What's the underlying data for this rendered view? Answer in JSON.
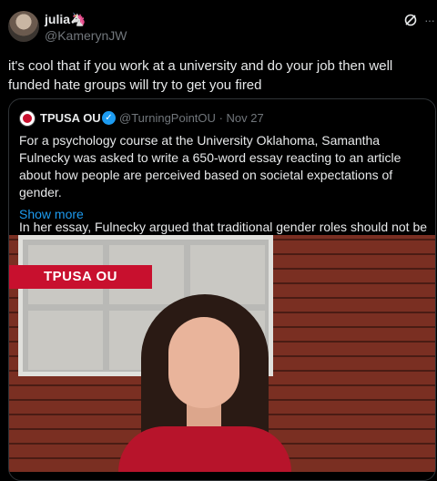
{
  "tweet": {
    "author_name": "julia🦄",
    "author_handle": "@KamerynJW",
    "text": "it's cool that if you work at a university and do your job then well funded hate groups will try to get you fired"
  },
  "quote": {
    "author_name": "TPUSA OU",
    "author_handle": "@TurningPointOU",
    "separator": "·",
    "date": "Nov 27",
    "paragraph1": "For a psychology course at the University Oklahoma, Samantha Fulnecky was asked to write a 650-word essay reacting to an article about how people are perceived based on societal expectations of gender.",
    "paragraph2": "In her essay, Fulnecky argued that traditional gender roles should not be",
    "show_more": "Show more",
    "image_banner": "TPUSA OU"
  },
  "icons": {
    "grok": "grok-icon",
    "more": "more-icon",
    "verified": "verified-badge-icon"
  },
  "colors": {
    "background": "#000000",
    "link": "#1d9bf0",
    "muted": "#71767b",
    "banner": "#c8102e"
  }
}
